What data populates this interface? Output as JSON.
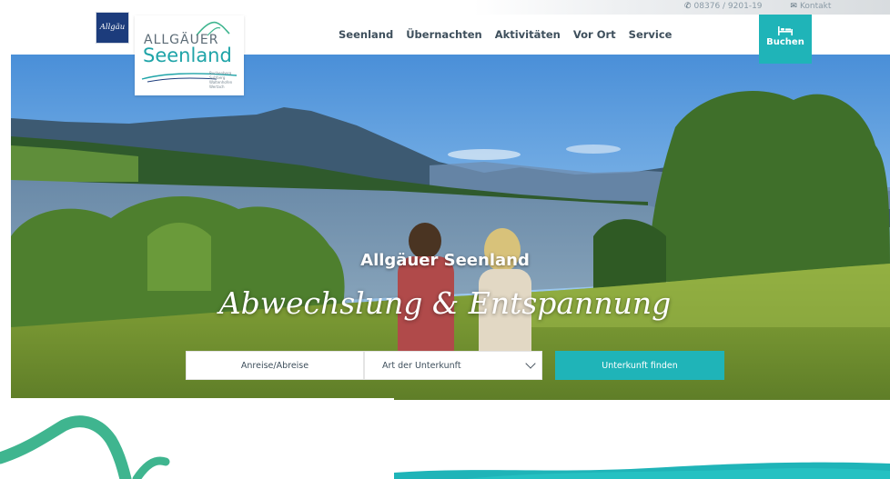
{
  "contact": {
    "phone": "08376 / 9201-19",
    "kontakt": "Kontakt"
  },
  "brand": {
    "badge_text": "Allgäu",
    "logo_line1": "ALLGÄUER",
    "logo_line2": "Seenland",
    "towns": [
      "Buchenberg",
      "Sulzberg",
      "Waltenhofen",
      "Wertach"
    ]
  },
  "nav": {
    "items": [
      "Seenland",
      "Übernachten",
      "Aktivitäten",
      "Vor Ort",
      "Service"
    ]
  },
  "booking": {
    "label": "Buchen",
    "icon": "bed-icon"
  },
  "hero": {
    "title": "Allgäuer Seenland",
    "tagline": "Abwechslung & Entspannung"
  },
  "search": {
    "dates_label": "Anreise/Abreise",
    "type_label": "Art der Unterkunft",
    "submit_label": "Unterkunft finden"
  },
  "colors": {
    "accent": "#1fb4b8",
    "nav_text": "#3e4f5c",
    "badge_blue": "#1c3c7c"
  }
}
